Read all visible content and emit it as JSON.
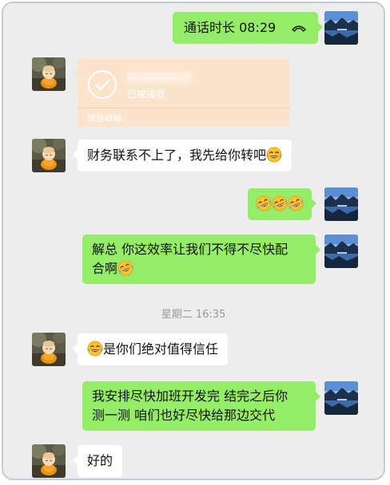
{
  "messages": [
    {
      "id": "m1",
      "side": "right",
      "type": "voice-call",
      "text": "通话时长 08:29",
      "icon": "phone-hangup-icon"
    },
    {
      "id": "m2",
      "side": "left",
      "type": "transfer",
      "status": "已被接收",
      "footer": "微信转账"
    },
    {
      "id": "m3",
      "side": "left",
      "text": "财务联系不上了，我先给你转吧",
      "trailing_emoji": "tears-of-joy-emoji"
    },
    {
      "id": "m4",
      "side": "right",
      "text": "",
      "emojis": [
        "tears-of-joy-emoji",
        "tears-of-joy-emoji",
        "tears-of-joy-emoji"
      ]
    },
    {
      "id": "m5",
      "side": "right",
      "line1": "解总 你这效率让我们不得不尽快配",
      "line2": "合啊",
      "trailing_emoji": "tears-of-joy-emoji"
    },
    {
      "id": "m6",
      "side": "left",
      "leading_emoji": "tears-of-joy-emoji",
      "text": "是你们绝对值得信任"
    },
    {
      "id": "m7",
      "side": "right",
      "line1": "我安排尽快加班开发完 结完之后你",
      "line2": "测一测 咱们也好尽快给那边交代"
    },
    {
      "id": "m8",
      "side": "left",
      "text": "好的"
    }
  ],
  "timestamp": "星期二 16:35",
  "colors": {
    "background": "#ededed",
    "outgoing_bubble": "#95ec69",
    "incoming_bubble": "#ffffff",
    "transfer_card": "#fbe4cc"
  }
}
